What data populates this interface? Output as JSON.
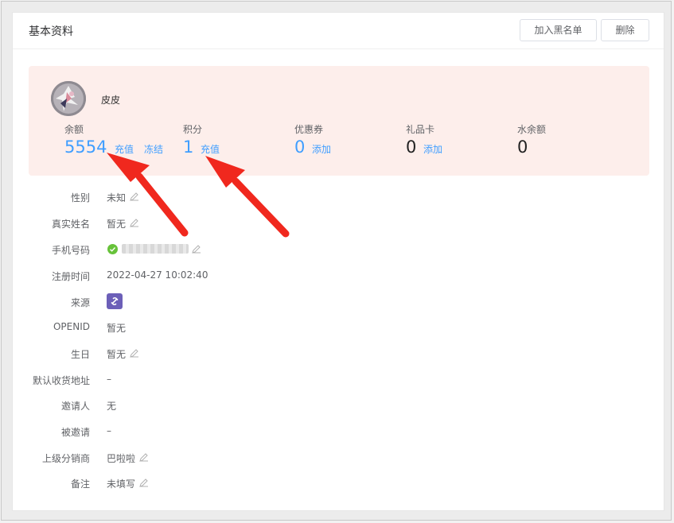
{
  "header": {
    "title": "基本资料",
    "blacklist_label": "加入黑名单",
    "delete_label": "删除"
  },
  "profile": {
    "nickname": "皮皮"
  },
  "stats": {
    "balance": {
      "label": "余额",
      "value": "5554",
      "recharge": "充值",
      "freeze": "冻结"
    },
    "points": {
      "label": "积分",
      "value": "1",
      "recharge": "充值"
    },
    "coupons": {
      "label": "优惠券",
      "value": "0",
      "add": "添加"
    },
    "gift_cards": {
      "label": "礼品卡",
      "value": "0",
      "add": "添加"
    },
    "water_balance": {
      "label": "水余额",
      "value": "0"
    }
  },
  "fields": {
    "gender": {
      "label": "性别",
      "value": "未知"
    },
    "real_name": {
      "label": "真实姓名",
      "value": "暂无"
    },
    "phone": {
      "label": "手机号码"
    },
    "register_time": {
      "label": "注册时间",
      "value": "2022-04-27 10:02:40"
    },
    "source": {
      "label": "来源"
    },
    "openid": {
      "label": "OPENID",
      "value": "暂无"
    },
    "birthday": {
      "label": "生日",
      "value": "暂无"
    },
    "address": {
      "label": "默认收货地址",
      "value": "–"
    },
    "inviter": {
      "label": "邀请人",
      "value": "无"
    },
    "invited": {
      "label": "被邀请",
      "value": "–"
    },
    "distributor": {
      "label": "上级分销商",
      "value": "巴啦啦"
    },
    "remark": {
      "label": "备注",
      "value": "未填写"
    }
  },
  "colors": {
    "accent": "#409eff",
    "summary_bg": "#fdeeeb",
    "annotation": "#f0281e",
    "verified": "#67c23a",
    "source_badge": "#6c5fb8"
  },
  "icons": {
    "edit": "pencil-icon",
    "verified": "check-circle-icon",
    "source": "mini-program-link-icon"
  }
}
